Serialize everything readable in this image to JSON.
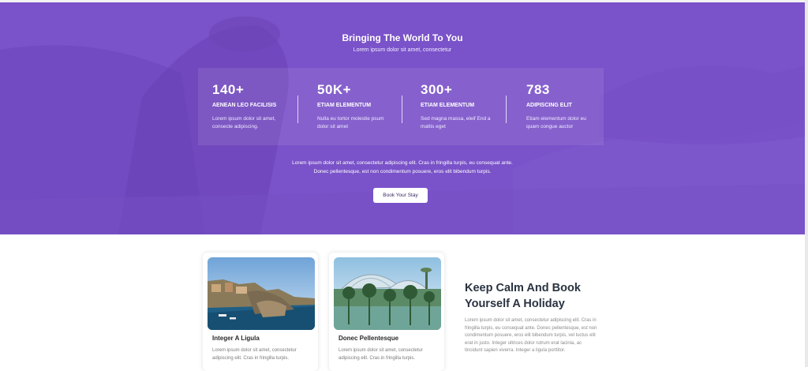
{
  "hero": {
    "title": "Bringing The World To You",
    "subtitle": "Lorem ipsum dolor sit amet, consectetur",
    "paragraph_line1": "Lorem ipsum dolor sit amet, consectetur adipiscing elit. Cras in fringilla turpis, eu consequat ante.",
    "paragraph_line2": "Donec pellentesque, est non condimentum posuere, eros elit bibendum turpis.",
    "button_label": "Book Your Stay",
    "overlay_color": "#7a52c9"
  },
  "stats": [
    {
      "value": "140+",
      "label": "AENEAN LEO FACILISIS",
      "desc": "Lorem ipsum dolor sit amet, consecte adipiscing."
    },
    {
      "value": "50K+",
      "label": "ETIAM ELEMENTUM",
      "desc": "Nulla eu tortor molestie psum dolor sit amet"
    },
    {
      "value": "300+",
      "label": "ETIAM ELEMENTUM",
      "desc": "Sed magna massa, eleif End a mattis eget"
    },
    {
      "value": "783",
      "label": "ADIPISCING ELIT",
      "desc": "Etiam elementum dolor eu quam congue auctor"
    }
  ],
  "cards": [
    {
      "title": "Integer A Ligula",
      "text": "Lorem ipsum dolor sit amet, consectetur adipiscing elit. Cras in fringilla turpis."
    },
    {
      "title": "Donec Pellentesque",
      "text": "Lorem ipsum dolor sit amet, consectetur adipiscing elit. Cras in fringilla turpis."
    }
  ],
  "side": {
    "title": "Keep Calm And Book Yourself A Holiday",
    "text": "Lorem ipsum dolor sit amet, consectetur adipiscing elit. Cras in fringilla turpis, eu consequat ante. Donec pellentesque, est non condimentum posuere, eros elit bibendum turpis, vel luctus elit erat in justo. Integer ultrices dolor rutrum erat lacinia, ac tincidunt sapien viverra. Integer a ligula porttitor."
  }
}
